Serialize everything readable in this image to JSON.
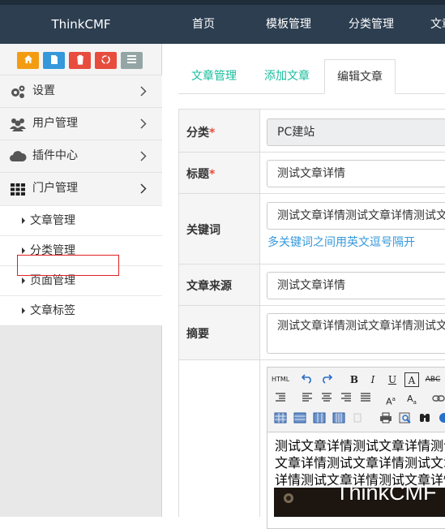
{
  "header": {
    "brand": "ThinkCMF",
    "nav": [
      "首页",
      "模板管理",
      "分类管理",
      "文章"
    ]
  },
  "sidebar": {
    "shortcuts": [
      {
        "icon": "home-icon",
        "color": "#f39c12"
      },
      {
        "icon": "file-icon",
        "color": "#3498db"
      },
      {
        "icon": "trash-icon",
        "color": "#e74c3c"
      },
      {
        "icon": "recycle-icon",
        "color": "#e74c3c"
      },
      {
        "icon": "list-icon",
        "color": "#95a5a6"
      }
    ],
    "menu": [
      {
        "label": "设置",
        "icon": "gears-icon"
      },
      {
        "label": "用户管理",
        "icon": "users-icon"
      },
      {
        "label": "插件中心",
        "icon": "cloud-icon"
      },
      {
        "label": "门户管理",
        "icon": "grid-icon"
      }
    ],
    "submenu": [
      "文章管理",
      "分类管理",
      "页面管理",
      "文章标签"
    ]
  },
  "tabs": [
    "文章管理",
    "添加文章",
    "编辑文章"
  ],
  "form": {
    "category": {
      "label": "分类",
      "required": "*",
      "value": "PC建站"
    },
    "title": {
      "label": "标题",
      "required": "*",
      "value": "测试文章详情"
    },
    "keywords": {
      "label": "关键词",
      "value": "测试文章详情测试文章详情测试文",
      "help": "多关键词之间用英文逗号隔开"
    },
    "source": {
      "label": "文章来源",
      "value": "测试文章详情"
    },
    "summary": {
      "label": "摘要",
      "value": "测试文章详情测试文章详情测试文"
    }
  },
  "editor": {
    "lines": [
      "测试文章详情测试文章详情测试",
      "文章详情测试文章详情测试文章",
      "详情测试文章详情测试文章详情"
    ],
    "html_label": "HTML",
    "watermark": "ThinkCMF"
  },
  "colors": {
    "accent": "#18bc9c",
    "header": "#2c3e50",
    "required": "#e74c3c",
    "help": "#3498db"
  }
}
